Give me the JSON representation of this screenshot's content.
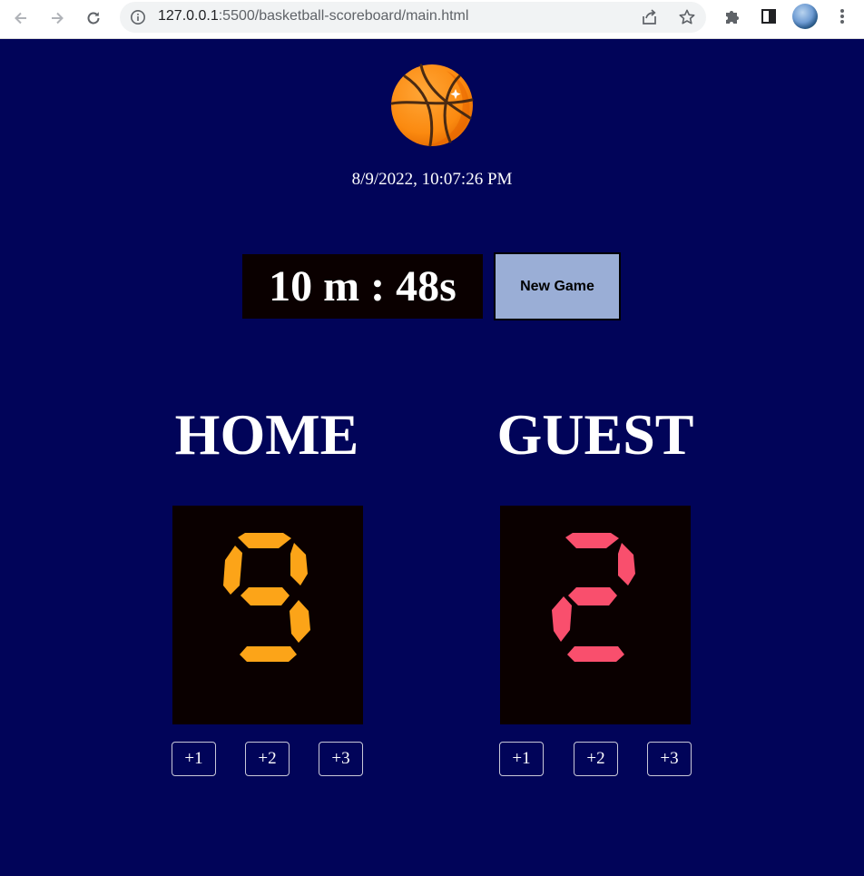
{
  "browser": {
    "url_host": "127.0.0.1",
    "url_path": ":5500/basketball-scoreboard/main.html"
  },
  "page": {
    "logo_icon": "basketball-icon",
    "datetime": "8/9/2022, 10:07:26 PM",
    "timer": "10 m : 48s",
    "new_game_label": "New Game"
  },
  "home": {
    "title": "HOME",
    "score": 9,
    "color": "#fca418",
    "buttons": [
      "+1",
      "+2",
      "+3"
    ]
  },
  "guest": {
    "title": "GUEST",
    "score": 2,
    "color": "#f94f6d",
    "buttons": [
      "+1",
      "+2",
      "+3"
    ]
  },
  "colors": {
    "background": "#010459",
    "score_panel": "#0a0000",
    "new_game_bg": "#9aaed6"
  }
}
